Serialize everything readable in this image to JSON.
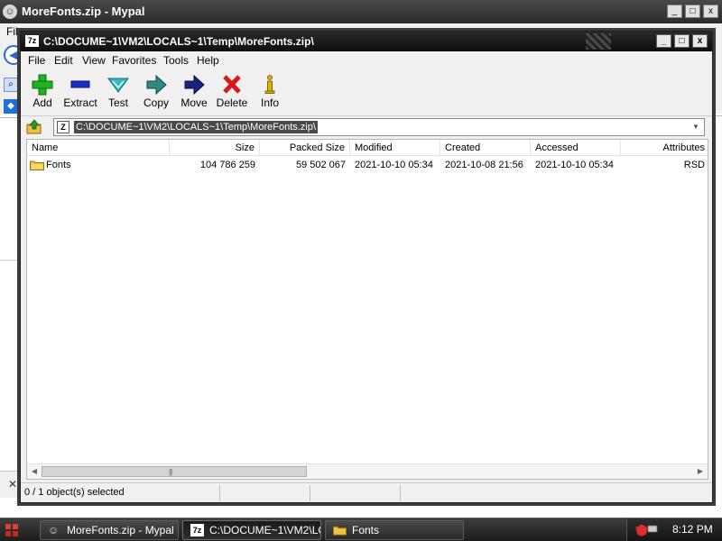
{
  "background_window": {
    "title": "MoreFonts.zip - Mypal",
    "menu_first": "File",
    "controls": [
      "_",
      "□",
      "x"
    ]
  },
  "window": {
    "title": "C:\\DOCUME~1\\VM2\\LOCALS~1\\Temp\\MoreFonts.zip\\",
    "app_icon": "7z",
    "controls": [
      "_",
      "□",
      "x"
    ]
  },
  "menu": [
    "File",
    "Edit",
    "View",
    "Favorites",
    "Tools",
    "Help"
  ],
  "toolbar": [
    {
      "label": "Add",
      "icon": "plus-icon",
      "color": "#1fb41f"
    },
    {
      "label": "Extract",
      "icon": "minus-icon",
      "color": "#1b2fc8"
    },
    {
      "label": "Test",
      "icon": "check-chevron-icon",
      "color": "#36b8c8"
    },
    {
      "label": "Copy",
      "icon": "arrow-right-icon",
      "color": "#2c8a7e"
    },
    {
      "label": "Move",
      "icon": "arrow-right-icon",
      "color": "#1a237e"
    },
    {
      "label": "Delete",
      "icon": "x-icon",
      "color": "#d81818"
    },
    {
      "label": "Info",
      "icon": "info-icon",
      "color": "#e0b000"
    }
  ],
  "address": {
    "path": "C:\\DOCUME~1\\VM2\\LOCALS~1\\Temp\\MoreFonts.zip\\"
  },
  "columns": [
    "Name",
    "Size",
    "Packed Size",
    "Modified",
    "Created",
    "Accessed",
    "Attributes"
  ],
  "rows": [
    {
      "name": "Fonts",
      "size": "104 786 259",
      "packed_size": "59 502 067",
      "modified": "2021-10-10 05:34",
      "created": "2021-10-08 21:56",
      "accessed": "2021-10-10 05:34",
      "attributes": "RSD"
    }
  ],
  "status": {
    "text": "0 / 1 object(s) selected"
  },
  "taskbar": {
    "tasks": [
      {
        "label": "MoreFonts.zip - Mypal",
        "icon": "mypal-icon"
      },
      {
        "label": "C:\\DOCUME~1\\VM2\\LO...",
        "icon": "7zip-icon"
      },
      {
        "label": "Fonts",
        "icon": "folder-icon"
      }
    ],
    "clock": "8:12 PM"
  },
  "colors": {
    "accent_selection": "#4a4a4a",
    "folder": "#f0c040"
  }
}
